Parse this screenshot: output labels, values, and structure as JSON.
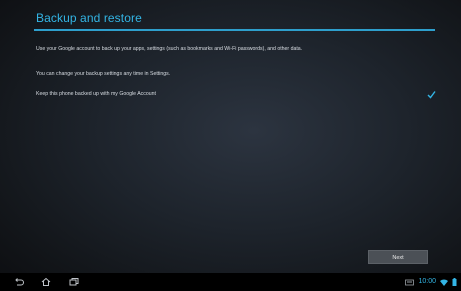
{
  "header": {
    "title": "Backup and restore"
  },
  "content": {
    "description": "Use your Google account to back up your apps, settings (such as bookmarks and Wi-Fi passwords), and other data.",
    "change_hint": "You can change your backup settings any time in Settings.",
    "backup_option": {
      "label": "Keep this phone backed up with my Google Account",
      "checked": true
    }
  },
  "actions": {
    "next_label": "Next"
  },
  "system_bar": {
    "time": "10:00",
    "icons": [
      "back-icon",
      "home-icon",
      "recent-apps-icon",
      "keyboard-icon",
      "wifi-icon",
      "battery-icon"
    ]
  },
  "colors": {
    "accent": "#33b5e5",
    "background": "#1d232b",
    "button": "#4b5056"
  }
}
